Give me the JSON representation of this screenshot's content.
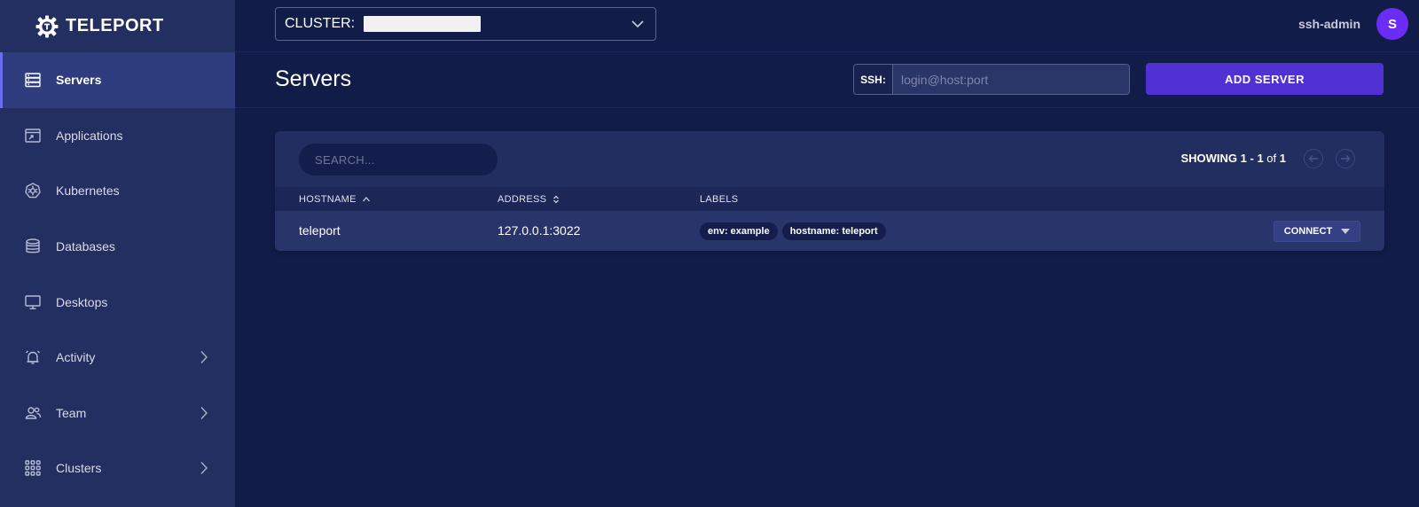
{
  "brand": {
    "name": "TELEPORT"
  },
  "sidebar": {
    "items": [
      {
        "label": "Servers",
        "icon": "server-icon",
        "active": true,
        "has_submenu": false
      },
      {
        "label": "Applications",
        "icon": "application-icon",
        "active": false,
        "has_submenu": false
      },
      {
        "label": "Kubernetes",
        "icon": "kubernetes-icon",
        "active": false,
        "has_submenu": false
      },
      {
        "label": "Databases",
        "icon": "database-icon",
        "active": false,
        "has_submenu": false
      },
      {
        "label": "Desktops",
        "icon": "desktop-icon",
        "active": false,
        "has_submenu": false
      },
      {
        "label": "Activity",
        "icon": "bell-icon",
        "active": false,
        "has_submenu": true
      },
      {
        "label": "Team",
        "icon": "team-icon",
        "active": false,
        "has_submenu": true
      },
      {
        "label": "Clusters",
        "icon": "grid-icon",
        "active": false,
        "has_submenu": true
      }
    ]
  },
  "topbar": {
    "cluster_label": "CLUSTER:",
    "cluster_value": "",
    "username": "ssh-admin",
    "avatar_initial": "S"
  },
  "page": {
    "title": "Servers",
    "ssh_label": "SSH:",
    "ssh_placeholder": "login@host:port",
    "add_button": "ADD SERVER"
  },
  "table": {
    "search_placeholder": "SEARCH...",
    "showing_prefix": "SHOWING",
    "showing_range": "1 - 1",
    "showing_of": "of",
    "showing_total": "1",
    "columns": {
      "hostname": "HOSTNAME",
      "address": "ADDRESS",
      "labels": "LABELS"
    },
    "rows": [
      {
        "hostname": "teleport",
        "address": "127.0.0.1:3022",
        "labels": [
          "env: example",
          "hostname: teleport"
        ],
        "action": "CONNECT"
      }
    ]
  },
  "colors": {
    "background": "#121c48",
    "sidebar": "#232e61",
    "accent": "#5131d3",
    "avatar": "#6b2cf5"
  }
}
